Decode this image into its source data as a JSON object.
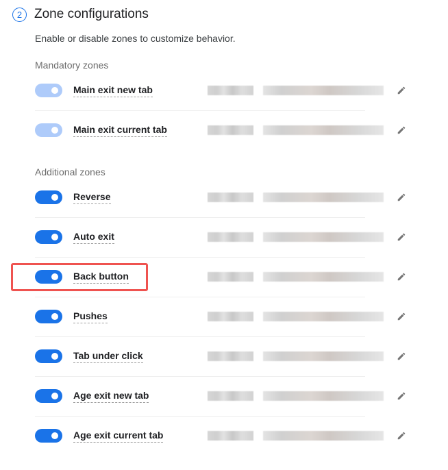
{
  "step": {
    "number": "2",
    "title": "Zone configurations"
  },
  "description": "Enable or disable zones to customize behavior.",
  "groups": [
    {
      "label": "Mandatory zones",
      "zones": [
        {
          "name": "Main exit new tab",
          "enabled": true,
          "locked": true
        },
        {
          "name": "Main exit current tab",
          "enabled": true,
          "locked": true
        }
      ]
    },
    {
      "label": "Additional zones",
      "zones": [
        {
          "name": "Reverse",
          "enabled": true,
          "locked": false
        },
        {
          "name": "Auto exit",
          "enabled": true,
          "locked": false
        },
        {
          "name": "Back button",
          "enabled": true,
          "locked": false,
          "highlighted": true
        },
        {
          "name": "Pushes",
          "enabled": true,
          "locked": false
        },
        {
          "name": "Tab under click",
          "enabled": true,
          "locked": false
        },
        {
          "name": "Age exit new tab",
          "enabled": true,
          "locked": false
        },
        {
          "name": "Age exit current tab",
          "enabled": true,
          "locked": false
        }
      ]
    }
  ],
  "colors": {
    "accent": "#1a73e8",
    "toggle_disabled": "#aecbfa",
    "highlight": "#ef5350"
  },
  "icons": {
    "edit": "pencil-icon",
    "toggle": "toggle-switch"
  }
}
